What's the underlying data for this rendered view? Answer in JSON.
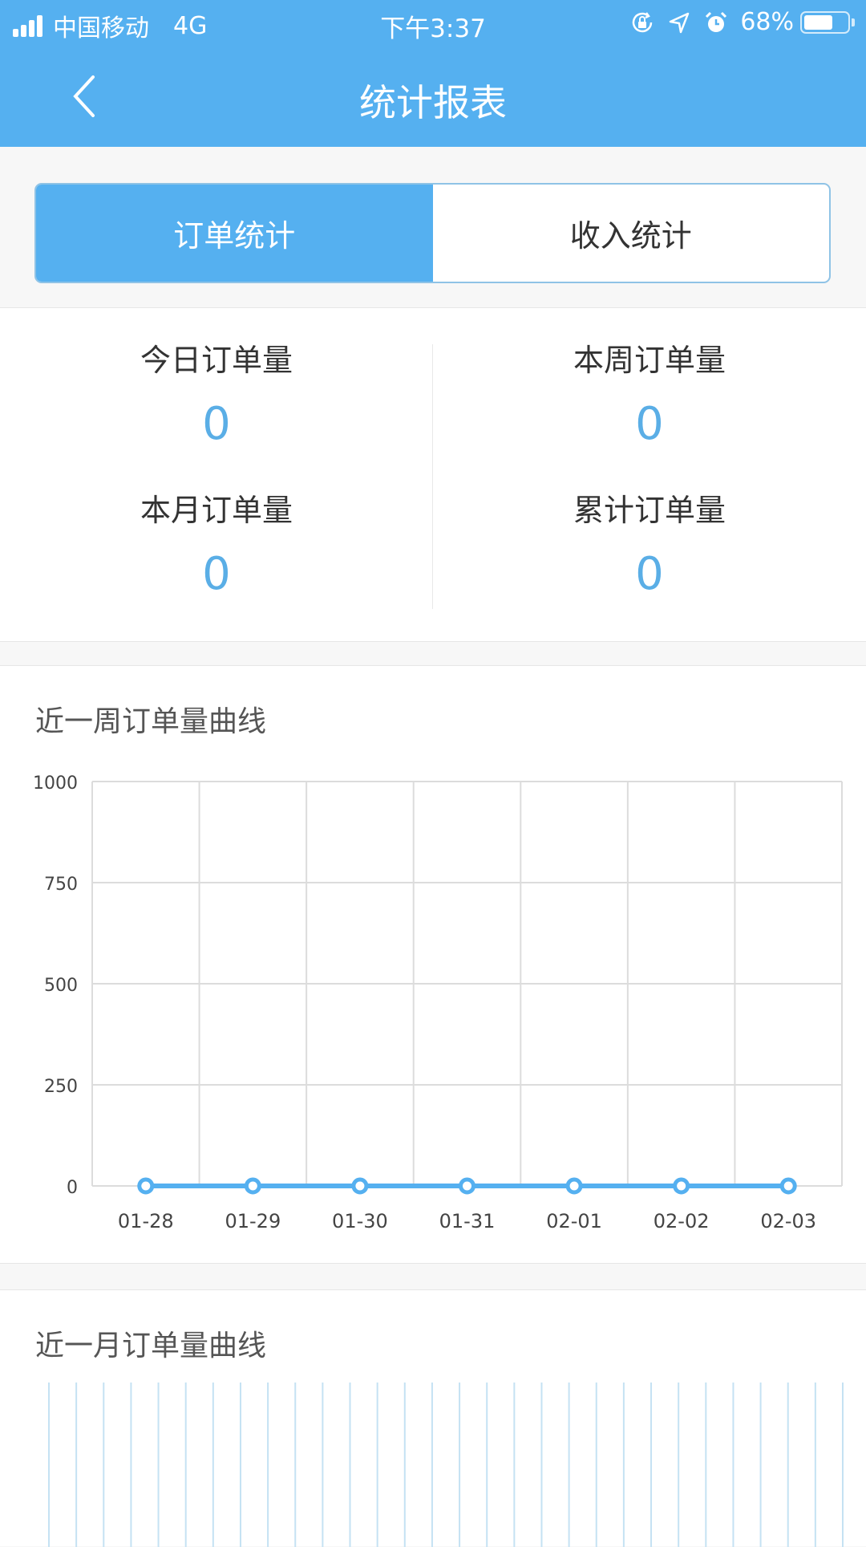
{
  "status_bar": {
    "carrier": "中国移动",
    "network": "4G",
    "time": "下午3:37",
    "battery_percent_label": "68%",
    "battery_level": 0.68,
    "icons": [
      "signal-icon",
      "rotation-lock-icon",
      "location-icon",
      "alarm-icon",
      "battery-icon"
    ]
  },
  "nav": {
    "title": "统计报表",
    "back_icon": "chevron-left-icon"
  },
  "tabs": [
    {
      "label": "订单统计",
      "active": true
    },
    {
      "label": "收入统计",
      "active": false
    }
  ],
  "stats": [
    {
      "label": "今日订单量",
      "value": "0"
    },
    {
      "label": "本周订单量",
      "value": "0"
    },
    {
      "label": "本月订单量",
      "value": "0"
    },
    {
      "label": "累计订单量",
      "value": "0"
    }
  ],
  "colors": {
    "brand": "#55b0f0",
    "stat_value": "#5aaee6",
    "line": "#55b0f0",
    "grid": "#dcdcdc",
    "month_grid": "#c5e2f3"
  },
  "chart_data": [
    {
      "type": "line",
      "title": "近一周订单量曲线",
      "xlabel": "",
      "ylabel": "",
      "categories": [
        "01-28",
        "01-29",
        "01-30",
        "01-31",
        "02-01",
        "02-02",
        "02-03"
      ],
      "series": [
        {
          "name": "订单量",
          "values": [
            0,
            0,
            0,
            0,
            0,
            0,
            0
          ]
        }
      ],
      "ylim": [
        0,
        1000
      ],
      "yticks": [
        0,
        250,
        500,
        750,
        1000
      ],
      "grid": true,
      "legend": "none"
    },
    {
      "type": "line",
      "title": "近一月订单量曲线",
      "grid_line_count": 30,
      "partially_visible": true
    }
  ]
}
